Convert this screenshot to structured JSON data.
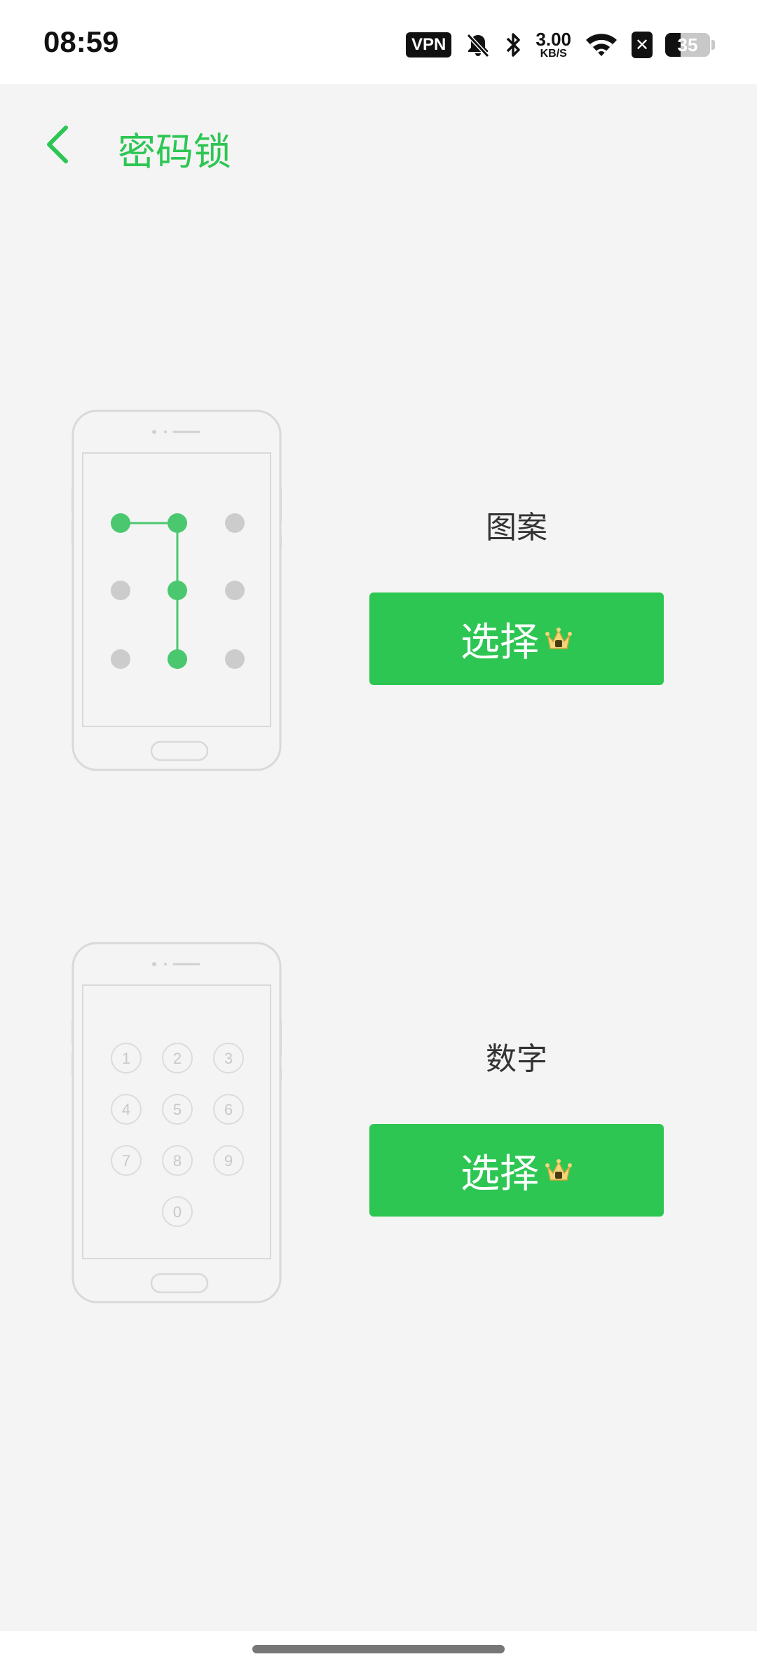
{
  "status": {
    "time": "08:59",
    "vpn": "VPN",
    "speed_value": "3.00",
    "speed_unit": "KB/S",
    "battery": "35",
    "battery_level": 0.35
  },
  "header": {
    "title": "密码锁",
    "back_icon": "chevron-left-icon"
  },
  "options": [
    {
      "label": "图案",
      "button": "选择"
    },
    {
      "label": "数字",
      "button": "选择"
    }
  ],
  "keypad": [
    "1",
    "2",
    "3",
    "4",
    "5",
    "6",
    "7",
    "8",
    "9",
    "0"
  ],
  "colors": {
    "accent": "#2dc653",
    "background": "#f4f4f4",
    "phone_outline": "#d9d9d9",
    "dot_inactive": "#cccccc"
  }
}
